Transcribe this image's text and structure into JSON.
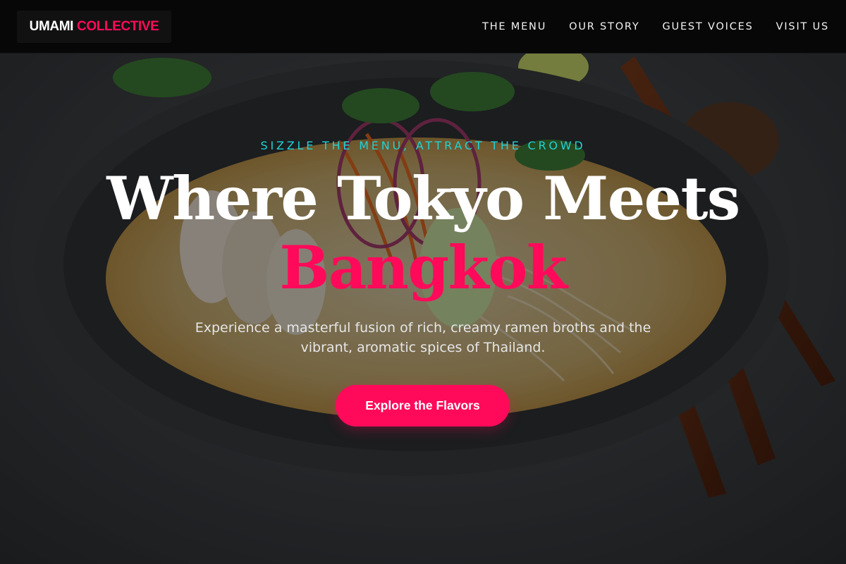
{
  "brand": {
    "name_part1": "UMAMI",
    "name_part2": "COLLECTIVE",
    "accent_color": "#ff0a5a"
  },
  "nav": {
    "items": [
      {
        "label": "THE MENU"
      },
      {
        "label": "OUR STORY"
      },
      {
        "label": "GUEST VOICES"
      },
      {
        "label": "VISIT US"
      }
    ]
  },
  "hero": {
    "tagline": "SIZZLE THE MENU, ATTRACT THE CROWD",
    "tagline_color": "#1fd3d6",
    "headline_line1": "Where Tokyo Meets",
    "headline_line2": "Bangkok",
    "description": "Experience a masterful fusion of rich, creamy ramen broths and the vibrant, aromatic spices of Thailand.",
    "cta_label": "Explore the Flavors",
    "background_image": "ramen-bowl-photo"
  }
}
